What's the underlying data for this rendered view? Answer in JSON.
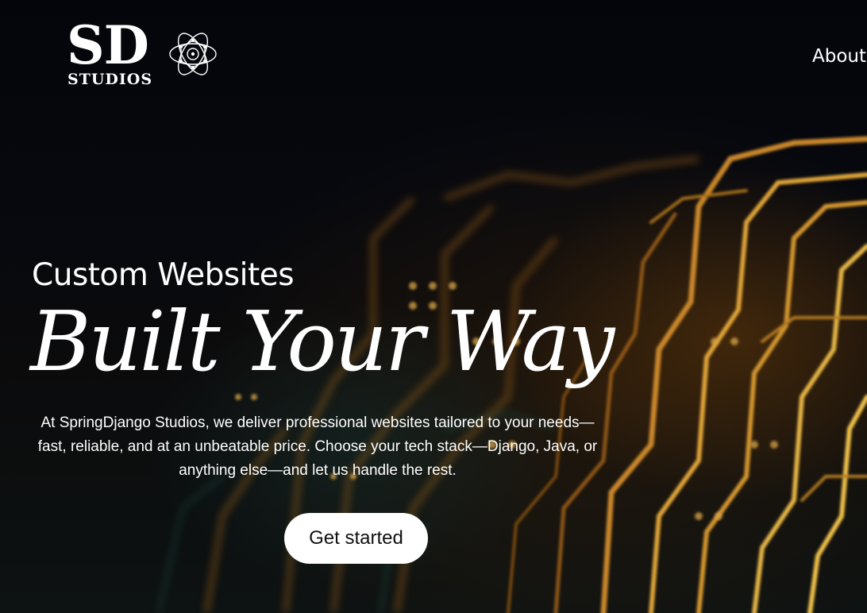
{
  "brand": {
    "logo_mark": "SD",
    "logo_sub": "STUDIOS",
    "icon": "atom-icon"
  },
  "nav": {
    "about_label": "About"
  },
  "hero": {
    "kicker": "Custom Websites",
    "title": "Built Your Way",
    "description": "At SpringDjango Studios, we deliver professional websites tailored to your needs—fast, reliable, and at an unbeatable price. Choose your tech stack—Django, Java, or anything else—and let us handle the rest.",
    "cta_label": "Get started",
    "background": "circuit-board-photo"
  },
  "colors": {
    "background": "#05070d",
    "text": "#ffffff",
    "button_bg": "#ffffff",
    "button_text": "#111111",
    "circuit_accent": "#d99a2b"
  }
}
